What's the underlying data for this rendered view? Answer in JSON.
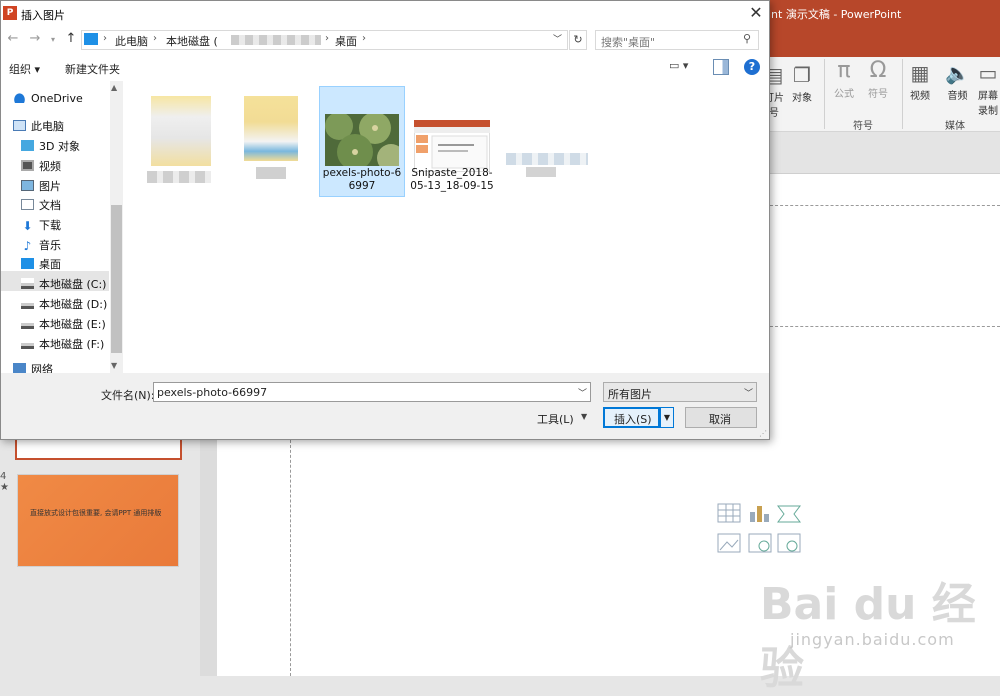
{
  "ppt": {
    "title": "int 演示文稿 - PowerPoint",
    "ribbon": {
      "btn_slide_num_line1": "灯片",
      "btn_slide_num_line2": "号",
      "btn_object": "对象",
      "btn_equation": "公式",
      "btn_symbol": "符号",
      "group_symbols": "符号",
      "btn_video": "视频",
      "btn_audio": "音频",
      "btn_screen_rec_line1": "屏幕",
      "btn_screen_rec_line2": "录制",
      "group_media": "媒体"
    },
    "slide_thumb_number": "4",
    "slide_thumb_star": "★",
    "slide_thumb_text": "直接放式设计包很重要, 会请PPT 通用排版",
    "watermark": "Bai du 经验",
    "watermark_sub": "jingyan.baidu.com"
  },
  "dialog": {
    "title": "插入图片",
    "close": "✕",
    "address": {
      "segments": [
        "此电脑",
        "本地磁盘 (",
        "桌面"
      ],
      "separator": "›"
    },
    "search_placeholder": "搜索\"桌面\"",
    "toolbar": {
      "organize": "组织 ▾",
      "new_folder": "新建文件夹"
    },
    "tree": [
      {
        "label": "OneDrive",
        "icon": "onedrive-icon"
      },
      {
        "label": "此电脑",
        "icon": "pc-icon"
      },
      {
        "label": "3D 对象",
        "icon": "cube-icon"
      },
      {
        "label": "视频",
        "icon": "video-icon"
      },
      {
        "label": "图片",
        "icon": "picture-icon"
      },
      {
        "label": "文档",
        "icon": "document-icon"
      },
      {
        "label": "下载",
        "icon": "download-icon"
      },
      {
        "label": "音乐",
        "icon": "music-icon"
      },
      {
        "label": "桌面",
        "icon": "desktop-icon"
      },
      {
        "label": "本地磁盘 (C:)",
        "icon": "drive-icon"
      },
      {
        "label": "本地磁盘 (D:)",
        "icon": "drive-icon"
      },
      {
        "label": "本地磁盘 (E:)",
        "icon": "drive-icon"
      },
      {
        "label": "本地磁盘 (F:)",
        "icon": "drive-icon"
      },
      {
        "label": "网络",
        "icon": "network-icon"
      }
    ],
    "files": [
      {
        "name": "pexels-photo-66997",
        "line1": "pexels-photo-6",
        "line2": "6997"
      },
      {
        "name": "Snipaste_2018-05-13_18-09-15",
        "line1": "Snipaste_2018-",
        "line2": "05-13_18-09-15"
      }
    ],
    "filename_label": "文件名(N):",
    "filename_value": "pexels-photo-66997",
    "filter_value": "所有图片",
    "tools_label": "工具(L)",
    "insert_label": "插入(S)",
    "cancel_label": "取消"
  }
}
